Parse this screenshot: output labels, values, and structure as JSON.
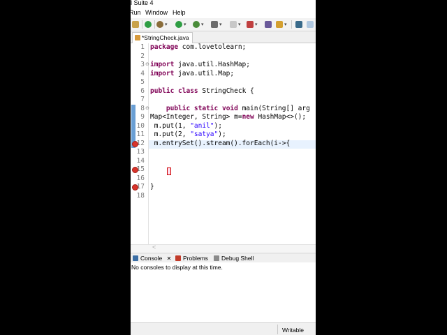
{
  "window": {
    "title": "l Suite 4"
  },
  "menu": [
    "Run",
    "Window",
    "Help"
  ],
  "toolbar": {
    "icons": [
      "sync-icon",
      "stop-icon",
      "debug-icon",
      "run-icon",
      "run-ext-icon",
      "new-icon",
      "coverage-icon",
      "package-icon",
      "search-icon",
      "pin-icon",
      "edit-icon"
    ]
  },
  "editor": {
    "tab_label": "*StringCheck.java",
    "lines": [
      {
        "n": "1",
        "segments": [
          {
            "t": "package ",
            "k": "kw"
          },
          {
            "t": "com.lovetolearn;",
            "k": ""
          }
        ]
      },
      {
        "n": "2",
        "segments": []
      },
      {
        "n": "3",
        "segments": [
          {
            "t": "import ",
            "k": "kw"
          },
          {
            "t": "java.util.HashMap;",
            "k": ""
          }
        ]
      },
      {
        "n": "4",
        "segments": [
          {
            "t": "import ",
            "k": "kw"
          },
          {
            "t": "java.util.Map;",
            "k": ""
          }
        ]
      },
      {
        "n": "5",
        "segments": []
      },
      {
        "n": "6",
        "segments": [
          {
            "t": "public ",
            "k": "kw"
          },
          {
            "t": "class ",
            "k": "kw"
          },
          {
            "t": "StringCheck {",
            "k": ""
          }
        ]
      },
      {
        "n": "7",
        "segments": []
      },
      {
        "n": "8",
        "segments": [
          {
            "t": "    public ",
            "k": "kw"
          },
          {
            "t": "static ",
            "k": "kw"
          },
          {
            "t": "void ",
            "k": "kw"
          },
          {
            "t": "main(String[] arg",
            "k": ""
          }
        ]
      },
      {
        "n": "9",
        "segments": [
          {
            "t": "Map<Integer, String> m=",
            "k": ""
          },
          {
            "t": "new ",
            "k": "kw"
          },
          {
            "t": "HashMap<>();",
            "k": ""
          }
        ]
      },
      {
        "n": "10",
        "segments": [
          {
            "t": " m.put(1, ",
            "k": ""
          },
          {
            "t": "\"anil\"",
            "k": "str"
          },
          {
            "t": ");",
            "k": ""
          }
        ]
      },
      {
        "n": "11",
        "segments": [
          {
            "t": " m.put(2, ",
            "k": ""
          },
          {
            "t": "\"satya\"",
            "k": "str"
          },
          {
            "t": ");",
            "k": ""
          }
        ]
      },
      {
        "n": "12",
        "segments": [
          {
            "t": " m.entrySet().stream().forEach(i->{",
            "k": ""
          }
        ]
      },
      {
        "n": "13",
        "segments": []
      },
      {
        "n": "14",
        "segments": []
      },
      {
        "n": "15",
        "segments": []
      },
      {
        "n": "16",
        "segments": []
      },
      {
        "n": "17",
        "segments": [
          {
            "t": "}",
            "k": ""
          }
        ]
      },
      {
        "n": "18",
        "segments": []
      }
    ],
    "fold_markers": [
      "3",
      "8"
    ],
    "error_lines": [
      "12",
      "15",
      "17"
    ],
    "hscroll_arrow": "<"
  },
  "views": {
    "tabs": [
      {
        "label": "Console",
        "icon": "console-icon",
        "close": "✕"
      },
      {
        "label": "Problems",
        "icon": "problems-icon"
      },
      {
        "label": "Debug Shell",
        "icon": "debug-shell-icon"
      }
    ],
    "console_message": "No consoles to display at this time."
  },
  "status": {
    "mode": "Writable"
  },
  "colors": {
    "keyword": "#7f0055",
    "string": "#2a00ff",
    "error": "#d9342b",
    "linenumber": "#787878"
  }
}
